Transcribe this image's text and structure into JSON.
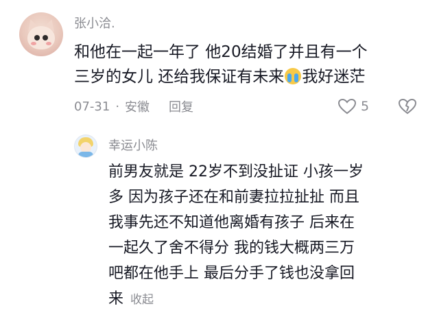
{
  "comment": {
    "username": "张小洽.",
    "text_line1": "和他在一起一年了 他20结婚了并且有一个",
    "text_line2_before_emoji": "三岁的女儿 还给我保证有未来",
    "emoji": "crying-face",
    "text_line2_after_emoji": "我好迷茫",
    "date": "07-31",
    "separator": "·",
    "location": "安徽",
    "reply_label": "回复",
    "like_count": "5"
  },
  "reply": {
    "username": "幸运小陈",
    "lines": [
      "前男友就是 22岁不到没扯证 小孩一岁",
      "多 因为孩子还在和前妻拉拉扯扯 而且",
      "我事先还不知道他离婚有孩子 后来在",
      "一起久了舍不得分 我的钱大概两三万",
      "吧都在他手上 最后分手了钱也没拿回",
      "来"
    ],
    "collapse_label": "收起"
  },
  "colors": {
    "text": "#161823",
    "muted": "#8a8b91"
  }
}
